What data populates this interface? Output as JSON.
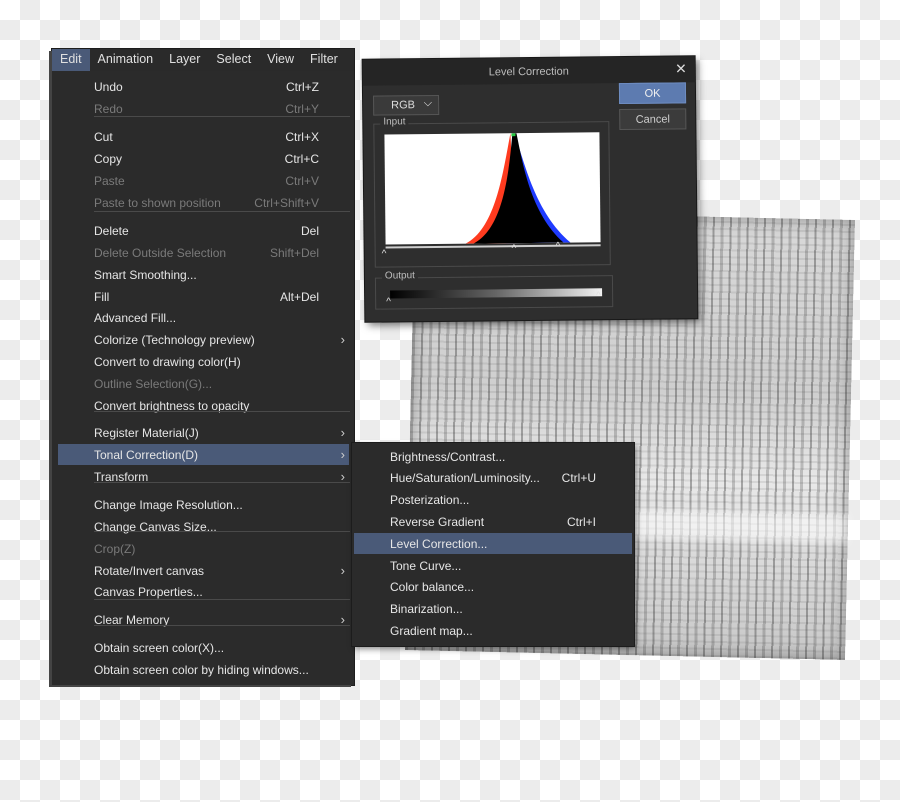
{
  "menubar": {
    "items": [
      "Edit",
      "Animation",
      "Layer",
      "Select",
      "View",
      "Filter"
    ],
    "active": "Edit"
  },
  "edit_menu": {
    "items": [
      {
        "label": "Undo",
        "shortcut": "Ctrl+Z",
        "disabled": false
      },
      {
        "label": "Redo",
        "shortcut": "Ctrl+Y",
        "disabled": true
      },
      {
        "label": "Cut",
        "shortcut": "Ctrl+X",
        "disabled": false
      },
      {
        "label": "Copy",
        "shortcut": "Ctrl+C",
        "disabled": false
      },
      {
        "label": "Paste",
        "shortcut": "Ctrl+V",
        "disabled": true
      },
      {
        "label": "Paste to shown position",
        "shortcut": "Ctrl+Shift+V",
        "disabled": true
      },
      {
        "label": "Delete",
        "shortcut": "Del",
        "disabled": false
      },
      {
        "label": "Delete Outside Selection",
        "shortcut": "Shift+Del",
        "disabled": true
      },
      {
        "label": "Smart Smoothing...",
        "shortcut": "",
        "disabled": false
      },
      {
        "label": "Fill",
        "shortcut": "Alt+Del",
        "disabled": false
      },
      {
        "label": "Advanced Fill...",
        "shortcut": "",
        "disabled": false
      },
      {
        "label": "Colorize (Technology preview)",
        "shortcut": "",
        "disabled": false,
        "submenu": true
      },
      {
        "label": "Convert to drawing color(H)",
        "shortcut": "",
        "disabled": false
      },
      {
        "label": "Outline Selection(G)...",
        "shortcut": "",
        "disabled": true
      },
      {
        "label": "Convert brightness to opacity",
        "shortcut": "",
        "disabled": false
      },
      {
        "label": "Register Material(J)",
        "shortcut": "",
        "disabled": false,
        "submenu": true
      },
      {
        "label": "Tonal Correction(D)",
        "shortcut": "",
        "disabled": false,
        "submenu": true,
        "highlighted": true
      },
      {
        "label": "Transform",
        "shortcut": "",
        "disabled": false,
        "submenu": true
      },
      {
        "label": "Change Image Resolution...",
        "shortcut": "",
        "disabled": false
      },
      {
        "label": "Change Canvas Size...",
        "shortcut": "",
        "disabled": false
      },
      {
        "label": "Crop(Z)",
        "shortcut": "",
        "disabled": true
      },
      {
        "label": "Rotate/Invert canvas",
        "shortcut": "",
        "disabled": false,
        "submenu": true
      },
      {
        "label": "Canvas Properties...",
        "shortcut": "",
        "disabled": false
      },
      {
        "label": "Clear Memory",
        "shortcut": "",
        "disabled": false,
        "submenu": true
      },
      {
        "label": "Obtain screen color(X)...",
        "shortcut": "",
        "disabled": false
      },
      {
        "label": "Obtain screen color by hiding windows...",
        "shortcut": "",
        "disabled": false
      }
    ]
  },
  "tonal_submenu": {
    "items": [
      {
        "label": "Brightness/Contrast...",
        "shortcut": ""
      },
      {
        "label": "Hue/Saturation/Luminosity...",
        "shortcut": "Ctrl+U"
      },
      {
        "label": "Posterization...",
        "shortcut": ""
      },
      {
        "label": "Reverse Gradient",
        "shortcut": "Ctrl+I"
      },
      {
        "label": "Level Correction...",
        "shortcut": "",
        "highlighted": true
      },
      {
        "label": "Tone Curve...",
        "shortcut": ""
      },
      {
        "label": "Color balance...",
        "shortcut": ""
      },
      {
        "label": "Binarization...",
        "shortcut": ""
      },
      {
        "label": "Gradient map...",
        "shortcut": ""
      }
    ]
  },
  "dialog": {
    "title": "Level Correction",
    "close_icon": "close-icon",
    "channel": "RGB",
    "ok_label": "OK",
    "cancel_label": "Cancel",
    "input_label": "Input",
    "output_label": "Output"
  },
  "colors": {
    "menu_bg": "#2b2b2b",
    "highlight": "#4a5a78",
    "ok_button": "#5d7bb0",
    "hist_red": "#ff3b1f",
    "hist_blue": "#1f3bff",
    "hist_green": "#27c93f"
  }
}
